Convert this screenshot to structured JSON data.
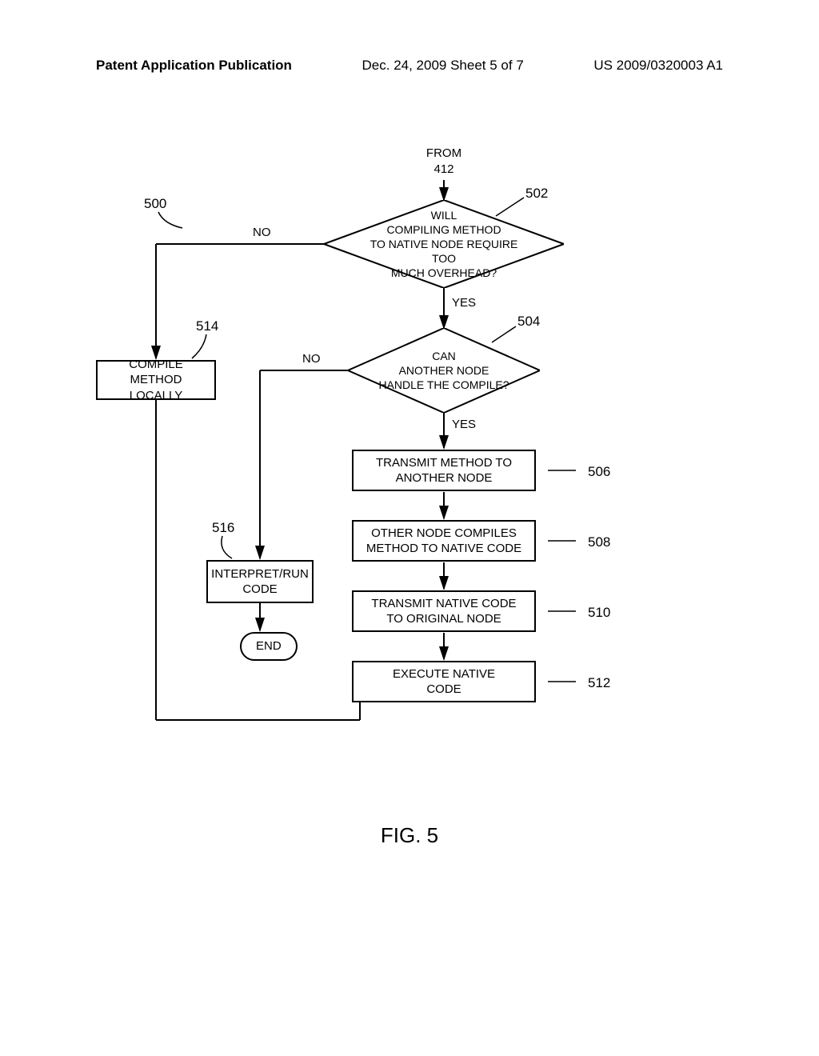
{
  "header": {
    "left": "Patent Application Publication",
    "center": "Dec. 24, 2009  Sheet 5 of 7",
    "right": "US 2009/0320003 A1"
  },
  "flowchart": {
    "from_label": "FROM\n412",
    "ref_500": "500",
    "ref_502": "502",
    "ref_504": "504",
    "ref_506": "506",
    "ref_508": "508",
    "ref_510": "510",
    "ref_512": "512",
    "ref_514": "514",
    "ref_516": "516",
    "decision_502": "WILL\nCOMPILING METHOD\nTO NATIVE NODE REQUIRE TOO\nMUCH OVERHEAD?",
    "decision_504": "CAN\nANOTHER NODE\nHANDLE THE COMPILE?",
    "box_514": "COMPILE METHOD\nLOCALLY",
    "box_516": "INTERPRET/RUN\nCODE",
    "box_506": "TRANSMIT METHOD TO\nANOTHER NODE",
    "box_508": "OTHER NODE COMPILES\nMETHOD TO NATIVE CODE",
    "box_510": "TRANSMIT NATIVE CODE\nTO ORIGINAL NODE",
    "box_512": "EXECUTE NATIVE\nCODE",
    "end": "END",
    "yes": "YES",
    "no": "NO"
  },
  "figure_label": "FIG. 5"
}
